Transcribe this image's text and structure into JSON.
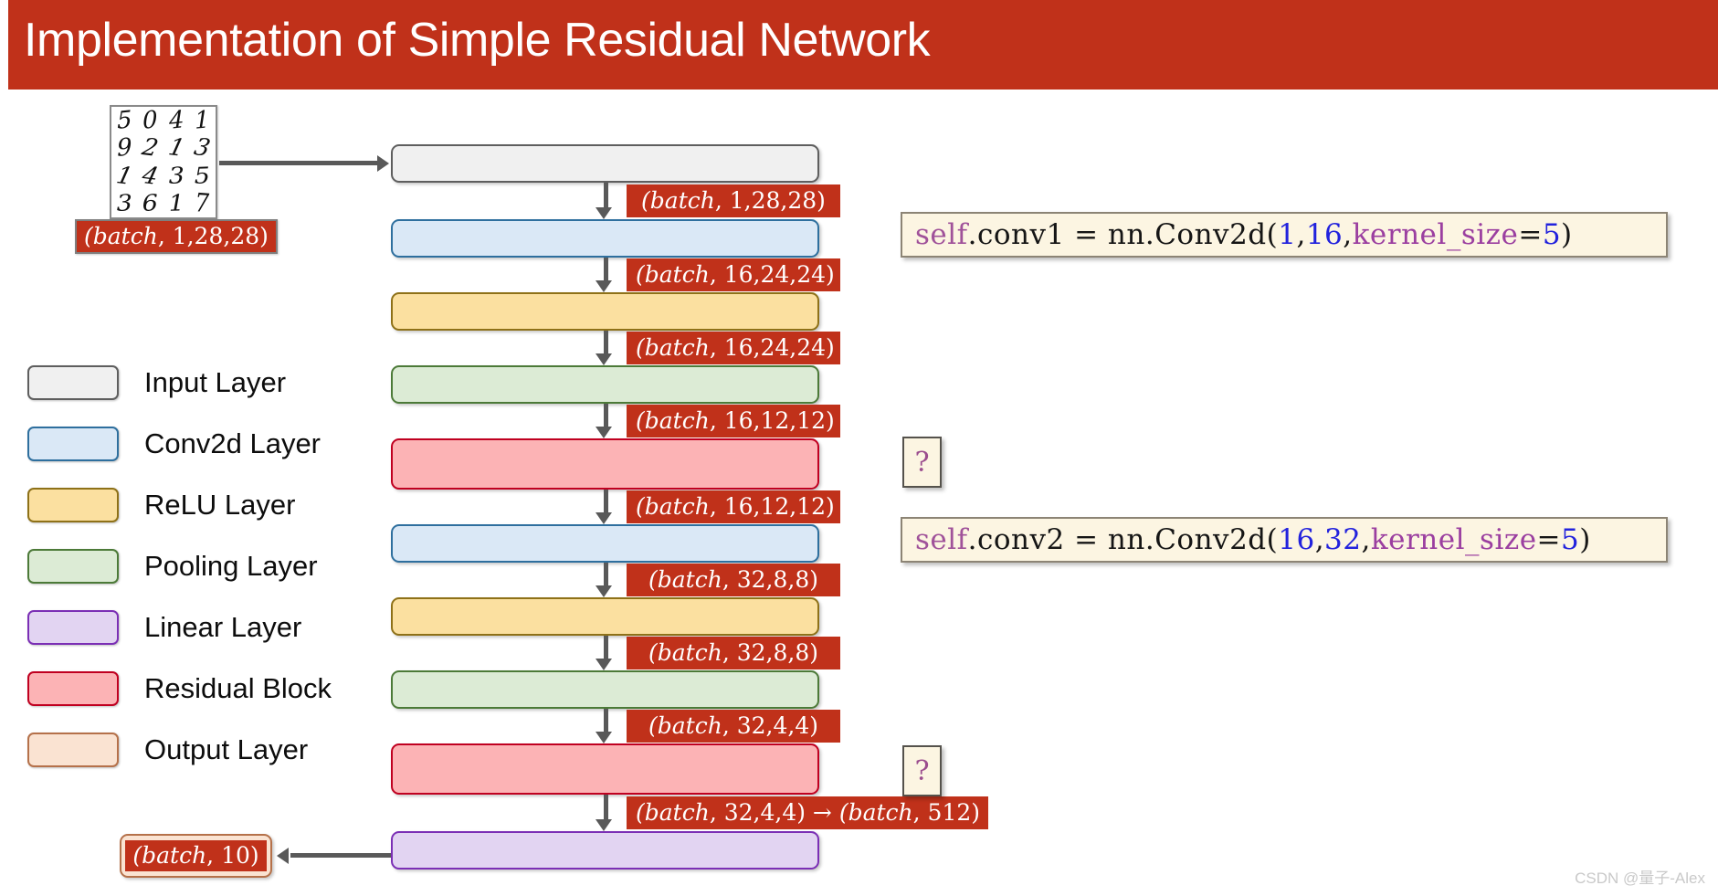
{
  "slide": {
    "title": "Implementation of Simple Residual Network",
    "banner_color": "#c0311a",
    "watermark": "CSDN @量子-Alex"
  },
  "legend": {
    "items": [
      {
        "label": "Input Layer",
        "fill": "#f0f0f0",
        "border": "#5e5e5e"
      },
      {
        "label": "Conv2d Layer",
        "fill": "#dae8f6",
        "border": "#2e6f9e"
      },
      {
        "label": "ReLU Layer",
        "fill": "#fbe0a0",
        "border": "#8e7118"
      },
      {
        "label": "Pooling Layer",
        "fill": "#dcebd5",
        "border": "#4c7a38"
      },
      {
        "label": "Linear Layer",
        "fill": "#e2d4f2",
        "border": "#7b2fb5"
      },
      {
        "label": "Residual Block",
        "fill": "#fcb3b5",
        "border": "#c00020"
      },
      {
        "label": "Output Layer",
        "fill": "#fae3d2",
        "border": "#b5714a"
      }
    ]
  },
  "input_thumbnail": {
    "digits": [
      "5",
      "0",
      "4",
      "1",
      "9",
      "2",
      "1",
      "3",
      "1",
      "4",
      "3",
      "5",
      "3",
      "6",
      "1",
      "7"
    ],
    "shape_badge": "(batch, 1,28,28)"
  },
  "flow": {
    "layers": [
      {
        "name": "input-layer",
        "type": "Input Layer",
        "fill": "#f0f0f0",
        "border": "#5e5e5e"
      },
      {
        "name": "conv2d-layer-1",
        "type": "Conv2d Layer",
        "fill": "#dae8f6",
        "border": "#2e6f9e"
      },
      {
        "name": "relu-layer-1",
        "type": "ReLU Layer",
        "fill": "#fbe0a0",
        "border": "#8e7118"
      },
      {
        "name": "pooling-layer-1",
        "type": "Pooling Layer",
        "fill": "#dcebd5",
        "border": "#4c7a38"
      },
      {
        "name": "residual-block-1",
        "type": "Residual Block",
        "fill": "#fcb3b5",
        "border": "#c00020"
      },
      {
        "name": "conv2d-layer-2",
        "type": "Conv2d Layer",
        "fill": "#dae8f6",
        "border": "#2e6f9e"
      },
      {
        "name": "relu-layer-2",
        "type": "ReLU Layer",
        "fill": "#fbe0a0",
        "border": "#8e7118"
      },
      {
        "name": "pooling-layer-2",
        "type": "Pooling Layer",
        "fill": "#dcebd5",
        "border": "#4c7a38"
      },
      {
        "name": "residual-block-2",
        "type": "Residual Block",
        "fill": "#fcb3b5",
        "border": "#c00020"
      },
      {
        "name": "linear-layer",
        "type": "Linear Layer",
        "fill": "#e2d4f2",
        "border": "#7b2fb5"
      }
    ],
    "shape_labels": [
      "(batch, 1,28,28)",
      "(batch, 16,24,24)",
      "(batch, 16,24,24)",
      "(batch, 16,12,12)",
      "(batch, 16,12,12)",
      "(batch, 32,8,8)",
      "(batch, 32,8,8)",
      "(batch, 32,4,4)",
      "(batch, 32,4,4) → (batch, 512)"
    ],
    "output_badge": "(batch, 10)"
  },
  "code": {
    "conv1": {
      "prefix": "self",
      "middle": ".conv1 = nn.Conv2d(",
      "arg1": "1",
      "sep1": ",  ",
      "arg2": "16",
      "sep2": ",  ",
      "kwarg": "kernel_size",
      "eq": "=",
      "arg3": "5",
      "suffix": ")"
    },
    "conv2": {
      "prefix": "self",
      "middle": ".conv2 = nn.Conv2d(",
      "arg1": "16",
      "sep1": ",  ",
      "arg2": "32",
      "sep2": ",  ",
      "kwarg": "kernel_size",
      "eq": "=",
      "arg3": "5",
      "suffix": ")"
    },
    "unknown_marker_1": "?",
    "unknown_marker_2": "?"
  }
}
